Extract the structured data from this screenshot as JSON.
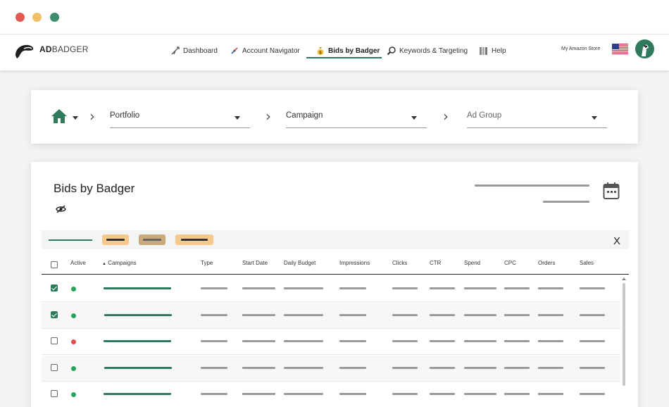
{
  "window": {
    "controls": [
      "close",
      "minimize",
      "maximize"
    ]
  },
  "brand": {
    "name_bold": "AD",
    "name_rest": "BADGER",
    "color": "#2f7a5b"
  },
  "nav": {
    "items": [
      {
        "label": "Dashboard",
        "icon": "telescope-icon"
      },
      {
        "label": "Account Navigator",
        "icon": "compass-icon"
      },
      {
        "label": "Bids by Badger",
        "icon": "money-bag-icon",
        "active": true
      },
      {
        "label": "Keywords & Targeting",
        "icon": "magnifier-icon"
      },
      {
        "label": "Help",
        "icon": "books-icon"
      }
    ],
    "store_label": "My Amazon Store",
    "flag": "us-flag-icon",
    "avatar": "badger-avatar-icon"
  },
  "filters": {
    "home_icon": "home-icon",
    "portfolio": {
      "label": "Portfolio"
    },
    "campaign": {
      "label": "Campaign"
    },
    "ad_group": {
      "label": "Ad Group"
    }
  },
  "main": {
    "title": "Bids by Badger",
    "visibility_icon": "eye-off-icon",
    "calendar_icon": "calendar-icon",
    "chips": [
      {
        "color": "#f6c98a"
      },
      {
        "color": "#c9a97a"
      },
      {
        "color": "#f6c98a"
      }
    ],
    "close_label": "X",
    "table": {
      "columns": [
        "Active",
        "Campaigns",
        "Type",
        "Start Date",
        "Daily Budget",
        "Impressions",
        "Clicks",
        "CTR",
        "Spend",
        "CPC",
        "Orders",
        "Sales"
      ],
      "sort_indicator": "▲",
      "rows": [
        {
          "checked": true,
          "status": "active",
          "status_color": "#27a55a"
        },
        {
          "checked": true,
          "status": "active",
          "status_color": "#27a55a"
        },
        {
          "checked": false,
          "status": "paused",
          "status_color": "#e24c4c"
        },
        {
          "checked": false,
          "status": "active",
          "status_color": "#27a55a"
        },
        {
          "checked": false,
          "status": "active",
          "status_color": "#27a55a"
        }
      ]
    }
  }
}
